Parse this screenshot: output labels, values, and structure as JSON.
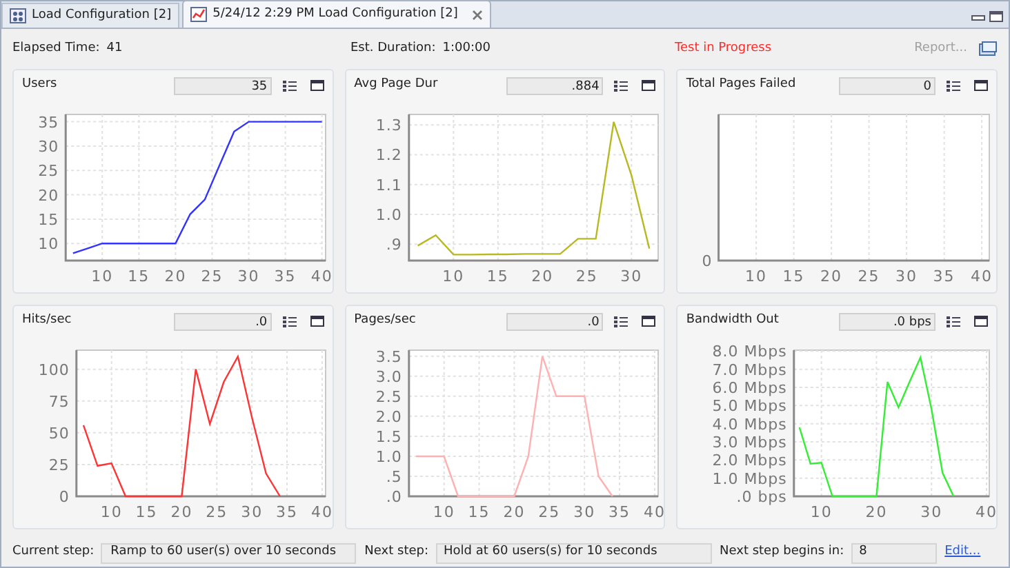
{
  "tabs": [
    {
      "label": "Load Configuration [2]",
      "selected": false,
      "kind": "config"
    },
    {
      "label": "5/24/12 2:29 PM Load Configuration [2]",
      "selected": true,
      "kind": "results"
    }
  ],
  "header": {
    "elapsed_label": "Elapsed Time:",
    "elapsed_value": "41",
    "duration_label": "Est. Duration:",
    "duration_value": "1:00:00",
    "status": "Test in Progress",
    "report_button": {
      "label": "Report...",
      "disabled": true
    }
  },
  "panels": [
    {
      "title": "Users",
      "value": "35",
      "chart_data": {
        "type": "line",
        "grid": true,
        "xlim": [
          5,
          40.5
        ],
        "ylim": [
          6.5,
          36.5
        ],
        "xticks": [
          10,
          15,
          20,
          25,
          30,
          35,
          40
        ],
        "yticks": [
          10,
          15,
          20,
          25,
          30,
          35
        ],
        "x": [
          6,
          8,
          10,
          12,
          14,
          16,
          18,
          20,
          22,
          24,
          26,
          28,
          30,
          32,
          34,
          36,
          38,
          40
        ],
        "series": [
          {
            "color": "#3333ff",
            "values": [
              8,
              9,
              10,
              10,
              10,
              10,
              10,
              10,
              16,
              19,
              26,
              33,
              35,
              35,
              35,
              35,
              35,
              35
            ]
          }
        ]
      }
    },
    {
      "title": "Avg Page Dur",
      "value": ".884",
      "chart_data": {
        "type": "line",
        "grid": true,
        "xlim": [
          5,
          33
        ],
        "ylim": [
          0.845,
          1.335
        ],
        "xticks": [
          10,
          15,
          20,
          25,
          30
        ],
        "yticks": [
          {
            "value": 0.9,
            "label": ".9"
          },
          {
            "value": 1.0,
            "label": "1.0"
          },
          {
            "value": 1.1,
            "label": "1.1"
          },
          {
            "value": 1.2,
            "label": "1.2"
          },
          {
            "value": 1.3,
            "label": "1.3"
          }
        ],
        "x": [
          6,
          8,
          10,
          12,
          14,
          16,
          18,
          20,
          22,
          24,
          26,
          28,
          30,
          32
        ],
        "series": [
          {
            "color": "#b8b820",
            "values": [
              0.895,
              0.93,
              0.865,
              0.865,
              0.866,
              0.866,
              0.867,
              0.867,
              0.867,
              0.918,
              0.918,
              1.31,
              1.13,
              0.885
            ]
          }
        ]
      }
    },
    {
      "title": "Total Pages Failed",
      "value": "0",
      "empty_chart": {
        "y_axis_labels": [
          "0"
        ],
        "x_axis_labels": [
          "10",
          "15",
          "20",
          "25",
          "30",
          "35",
          "40"
        ]
      }
    },
    {
      "title": "Hits/sec",
      "value": ".0",
      "chart_data": {
        "type": "line",
        "grid": true,
        "xlim": [
          5,
          40.5
        ],
        "ylim": [
          0,
          115
        ],
        "xticks": [
          10,
          15,
          20,
          25,
          30,
          35,
          40
        ],
        "yticks": [
          0,
          25,
          50,
          75,
          100
        ],
        "x": [
          6,
          8,
          10,
          12,
          14,
          16,
          18,
          20,
          22,
          24,
          26,
          28,
          30,
          32,
          34
        ],
        "series": [
          {
            "color": "#ff3333",
            "values": [
              56,
              24,
              26,
              0,
              0,
              0,
              0,
              0,
              100,
              57,
              90,
              110,
              62,
              18,
              0
            ]
          }
        ]
      }
    },
    {
      "title": "Pages/sec",
      "value": ".0",
      "chart_data": {
        "type": "line",
        "grid": true,
        "xlim": [
          5,
          40.5
        ],
        "ylim": [
          0,
          3.65
        ],
        "xticks": [
          10,
          15,
          20,
          25,
          30,
          35,
          40
        ],
        "yticks": [
          {
            "value": 0,
            "label": ".0"
          },
          {
            "value": 0.5,
            "label": ".5"
          },
          {
            "value": 1,
            "label": "1.0"
          },
          {
            "value": 1.5,
            "label": "1.5"
          },
          {
            "value": 2,
            "label": "2.0"
          },
          {
            "value": 2.5,
            "label": "2.5"
          },
          {
            "value": 3,
            "label": "3.0"
          },
          {
            "value": 3.5,
            "label": "3.5"
          }
        ],
        "x": [
          6,
          8,
          10,
          12,
          14,
          16,
          18,
          20,
          22,
          24,
          26,
          28,
          30,
          32,
          34
        ],
        "series": [
          {
            "color": "#ffb0b0",
            "values": [
              1,
              1,
              1,
              0,
              0,
              0,
              0,
              0,
              1,
              3.5,
              2.5,
              2.5,
              2.5,
              0.5,
              0
            ]
          }
        ]
      }
    },
    {
      "title": "Bandwidth Out",
      "value": ".0 bps",
      "chart_data": {
        "type": "line",
        "grid": true,
        "xlim": [
          5,
          40.5
        ],
        "ylim": [
          0,
          8.05
        ],
        "xticks": [
          10,
          20,
          30,
          40
        ],
        "yticks": [
          {
            "value": 0,
            "label": ".0 bps"
          },
          {
            "value": 1,
            "label": "1.0 Mbps"
          },
          {
            "value": 2,
            "label": "2.0 Mbps"
          },
          {
            "value": 3,
            "label": "3.0 Mbps"
          },
          {
            "value": 4,
            "label": "4.0 Mbps"
          },
          {
            "value": 5,
            "label": "5.0 Mbps"
          },
          {
            "value": 6,
            "label": "6.0 Mbps"
          },
          {
            "value": 7,
            "label": "7.0 Mbps"
          },
          {
            "value": 8,
            "label": "8.0 Mbps"
          }
        ],
        "x": [
          6,
          8,
          10,
          12,
          14,
          16,
          18,
          20,
          22,
          24,
          26,
          28,
          30,
          32,
          34
        ],
        "series": [
          {
            "color": "#33ee33",
            "values": [
              3.8,
              1.8,
              1.85,
              0,
              0,
              0,
              0,
              0,
              6.3,
              4.9,
              6.3,
              7.65,
              4.8,
              1.3,
              0
            ]
          }
        ]
      }
    }
  ],
  "footer": {
    "current_step_label": "Current step:",
    "current_step": "Ramp to 60 user(s) over 10 seconds",
    "next_step_label": "Next step:",
    "next_step": "Hold at 60 users(s) for 10 seconds",
    "begins_label": "Next step begins in:",
    "begins_value": "8",
    "edit_link": "Edit..."
  }
}
